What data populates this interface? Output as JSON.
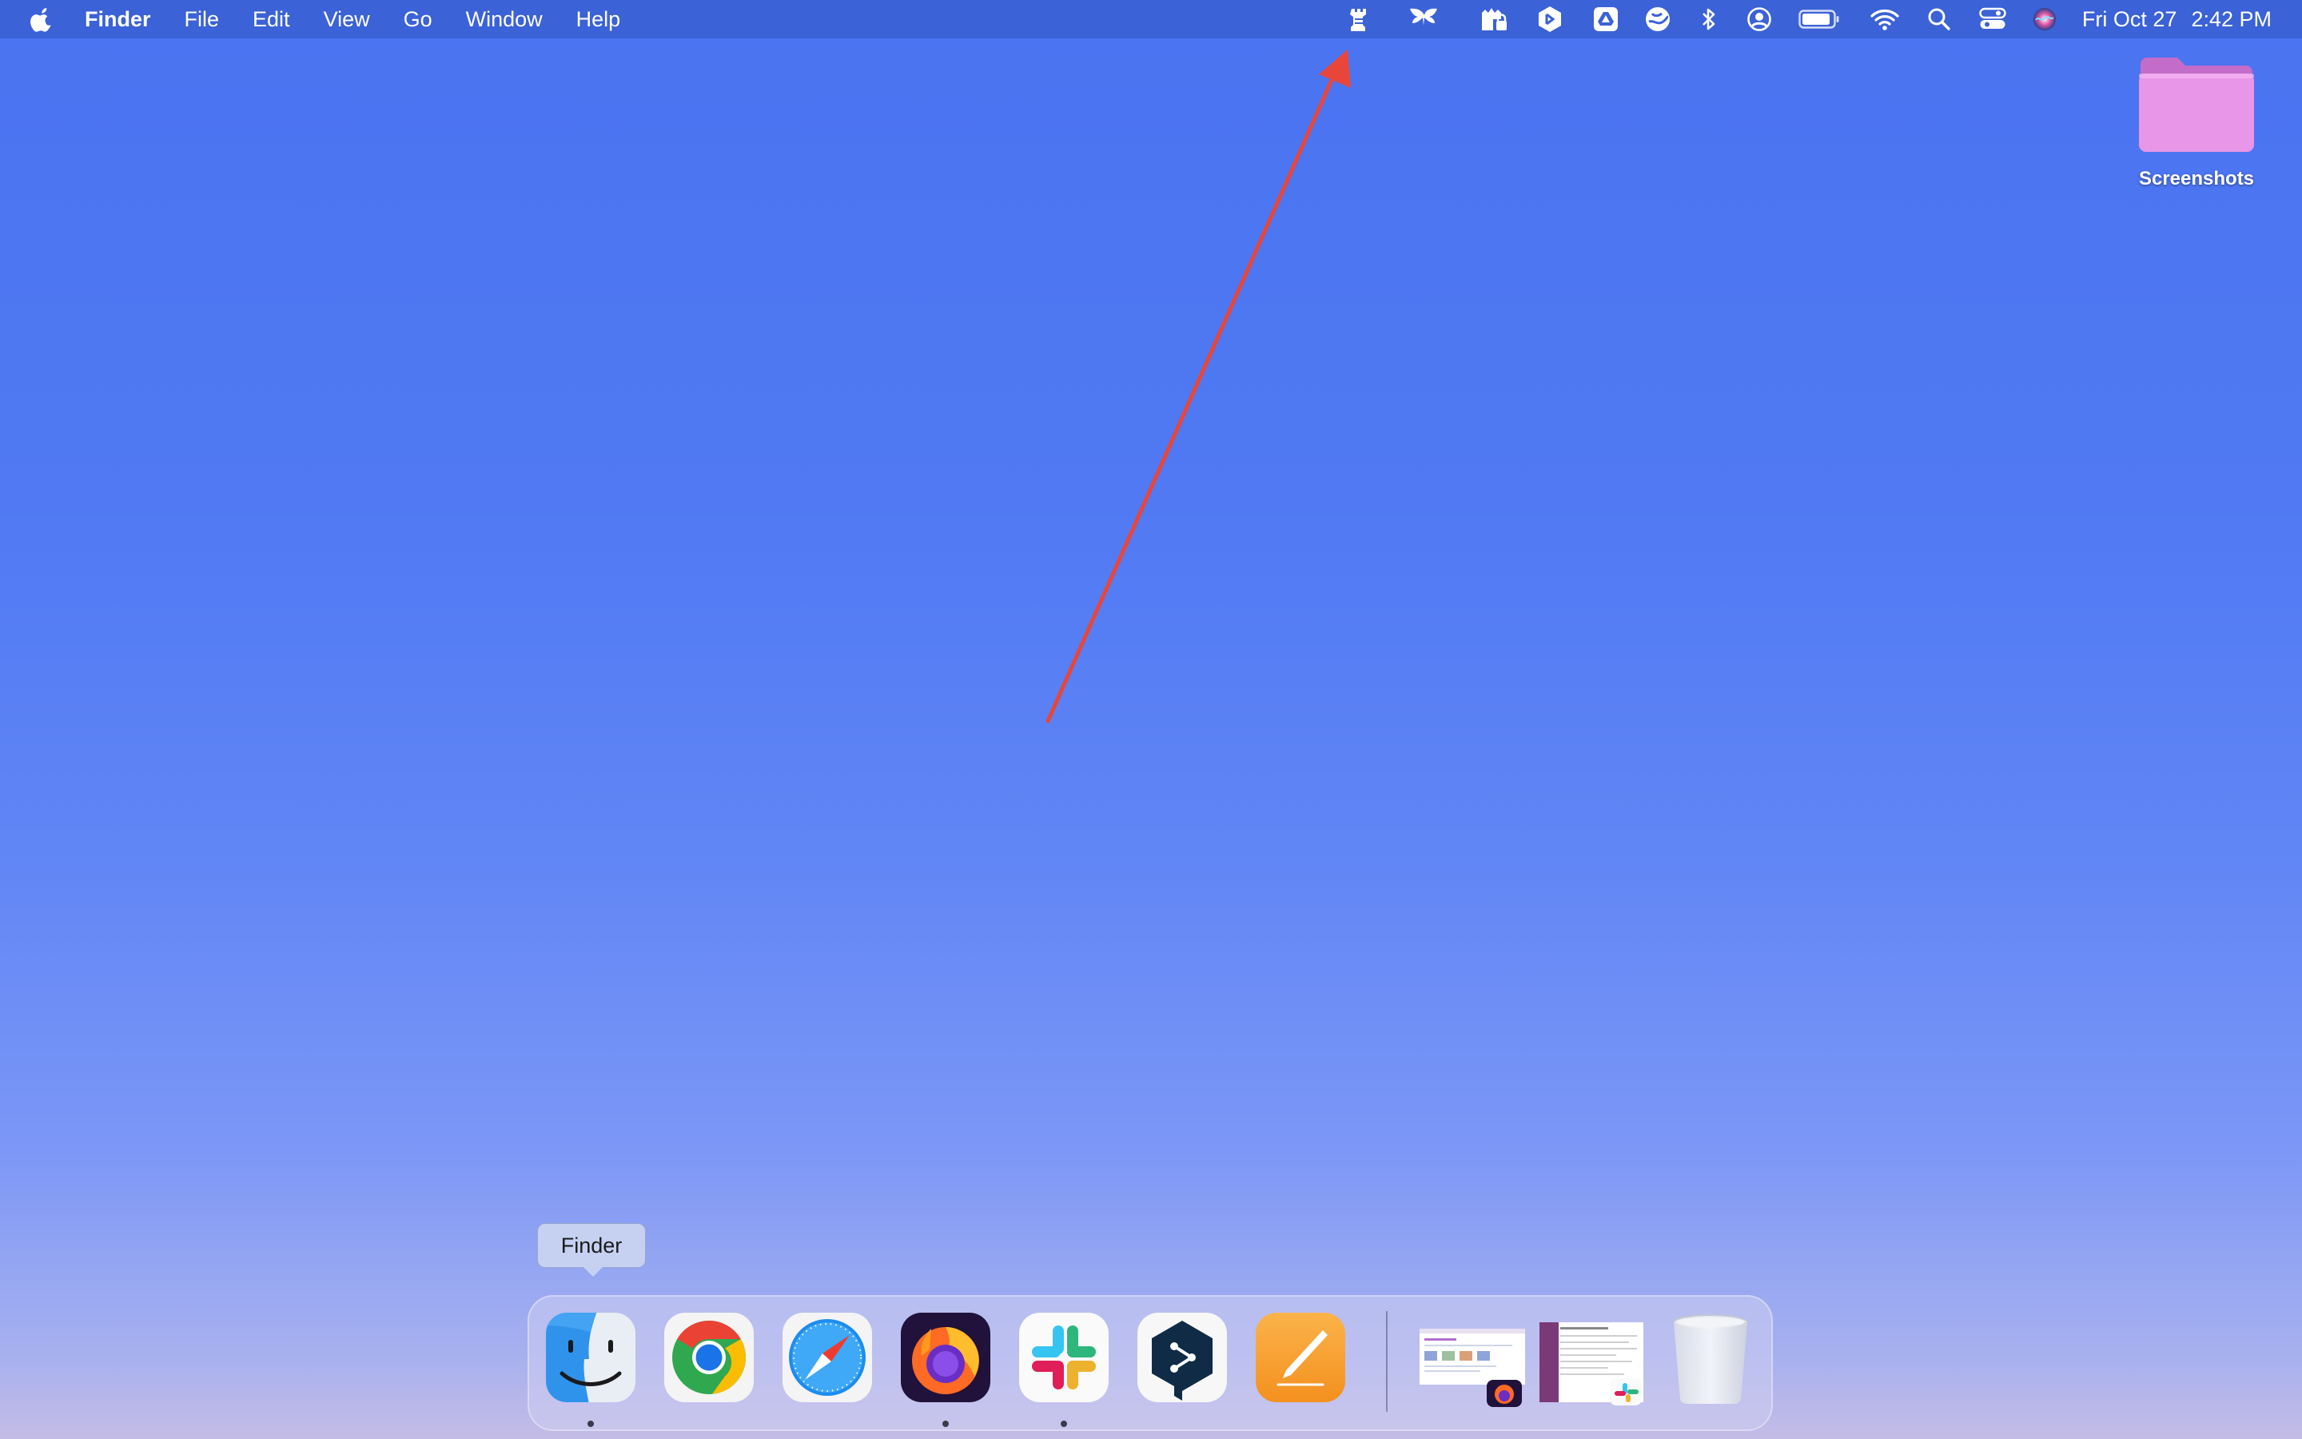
{
  "menubar": {
    "app_name": "Finder",
    "items": [
      "File",
      "Edit",
      "View",
      "Go",
      "Window",
      "Help"
    ],
    "date": "Fri Oct 27",
    "time": "2:42 PM",
    "status_icons": [
      "rook-icon",
      "butterfly-icon",
      "cloud-lock-icon",
      "hexagon-app-icon",
      "google-drive-icon",
      "sync-globe-icon",
      "bluetooth-icon",
      "user-account-icon",
      "battery-icon",
      "wifi-icon",
      "spotlight-search-icon",
      "control-center-icon",
      "siri-icon"
    ]
  },
  "desktop": {
    "folder_label": "Screenshots",
    "folder_color": "#e896e8"
  },
  "annotation": {
    "arrow_color": "#e8463a"
  },
  "dock": {
    "tooltip": "Finder",
    "apps": [
      "Finder",
      "Google Chrome",
      "Safari",
      "Firefox",
      "Slack",
      "DeepL",
      "Pages"
    ],
    "running": [
      "Finder",
      "Firefox",
      "Slack"
    ],
    "recent": [
      "Firefox window",
      "Slack window"
    ],
    "trash": "Trash"
  },
  "colors": {
    "menubar": "#3b62d6",
    "desktop_top": "#4a73f1",
    "desktop_bottom": "#c4bce6"
  }
}
